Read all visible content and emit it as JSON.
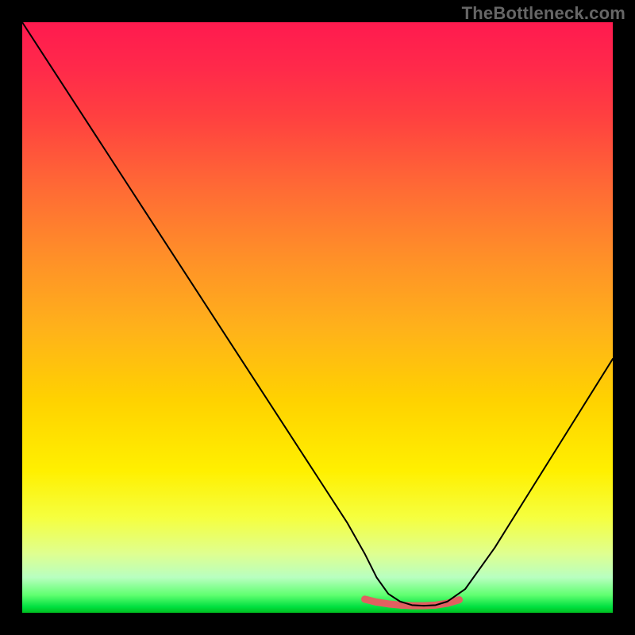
{
  "watermark": "TheBottleneck.com",
  "chart_data": {
    "type": "line",
    "title": "",
    "xlabel": "",
    "ylabel": "",
    "xlim": [
      0,
      100
    ],
    "ylim": [
      0,
      100
    ],
    "series": [
      {
        "name": "curve",
        "color": "#000000",
        "width": 2,
        "x": [
          0,
          5,
          10,
          15,
          20,
          25,
          30,
          35,
          40,
          45,
          50,
          55,
          58,
          60,
          62,
          64,
          66,
          68,
          70,
          72,
          75,
          80,
          85,
          90,
          95,
          100
        ],
        "y": [
          100,
          92.3,
          84.6,
          76.9,
          69.2,
          61.5,
          53.8,
          46.1,
          38.4,
          30.7,
          23.0,
          15.3,
          10.0,
          6.0,
          3.2,
          1.9,
          1.3,
          1.2,
          1.3,
          1.9,
          4.0,
          11.0,
          19.0,
          27.0,
          35.0,
          43.0
        ]
      },
      {
        "name": "highlight",
        "color": "#e06060",
        "width": 9,
        "x": [
          58,
          60,
          62,
          64,
          66,
          68,
          70,
          72,
          74
        ],
        "y": [
          2.3,
          1.8,
          1.5,
          1.3,
          1.2,
          1.2,
          1.3,
          1.6,
          2.2
        ]
      }
    ],
    "background_gradient": {
      "type": "vertical",
      "stops": [
        {
          "pos": 0.0,
          "color": "#ff1a4f"
        },
        {
          "pos": 0.3,
          "color": "#ff8028"
        },
        {
          "pos": 0.6,
          "color": "#ffe000"
        },
        {
          "pos": 0.85,
          "color": "#f0ff60"
        },
        {
          "pos": 0.97,
          "color": "#60ff70"
        },
        {
          "pos": 1.0,
          "color": "#00c020"
        }
      ]
    }
  }
}
